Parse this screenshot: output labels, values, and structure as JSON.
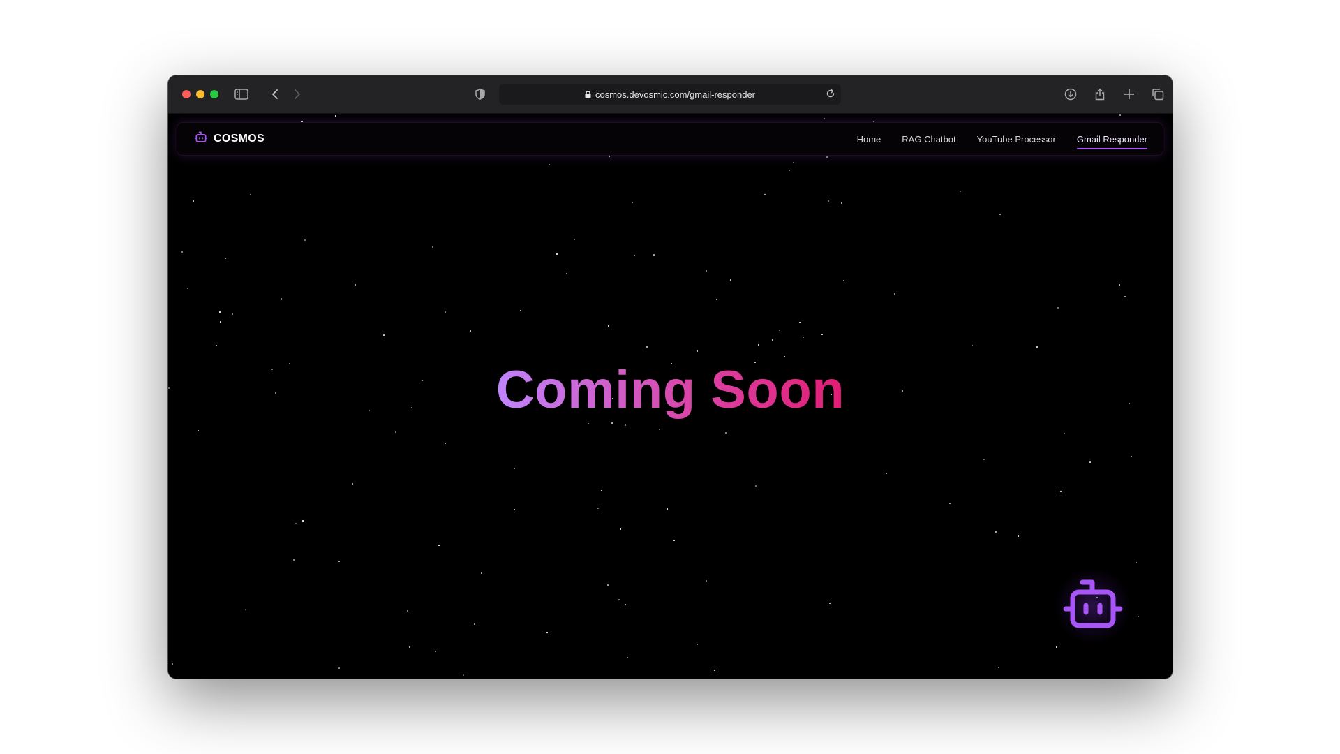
{
  "browser": {
    "url": "cosmos.devosmic.com/gmail-responder"
  },
  "navbar": {
    "brand": "COSMOS",
    "links": [
      {
        "label": "Home"
      },
      {
        "label": "RAG Chatbot"
      },
      {
        "label": "YouTube Processor"
      },
      {
        "label": "Gmail Responder",
        "active": true
      }
    ]
  },
  "hero": {
    "title": "Coming Soon"
  },
  "icons": {
    "brand": "robot-icon",
    "chat_fab": "robot-icon"
  },
  "colors": {
    "accent": "#a855f7",
    "gradient_start": "#c084fc",
    "gradient_end": "#e11d74",
    "background": "#000000"
  }
}
